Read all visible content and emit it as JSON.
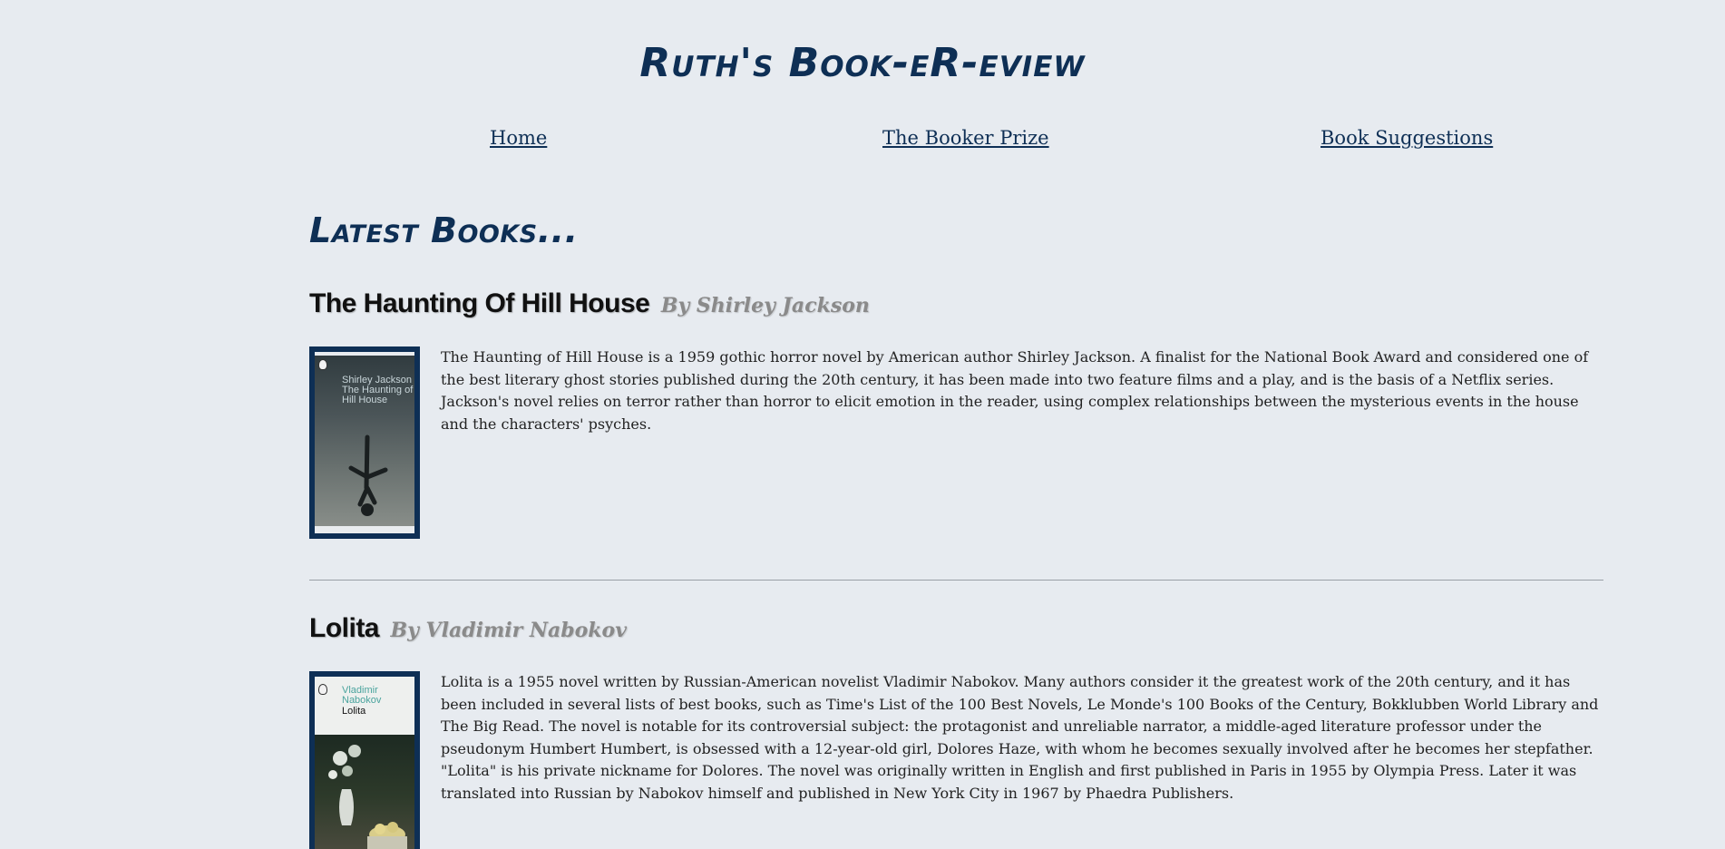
{
  "site": {
    "title": "Ruth's Book-eR-eview"
  },
  "nav": {
    "items": [
      {
        "label": "Home"
      },
      {
        "label": "The Booker Prize"
      },
      {
        "label": "Book Suggestions"
      }
    ]
  },
  "main": {
    "heading": "Latest Books...",
    "books": [
      {
        "title": "The Haunting Of Hill House",
        "author": "By Shirley Jackson",
        "cover": {
          "author": "Shirley Jackson",
          "title": "The Haunting of Hill House",
          "colors": {
            "frame": "#0e2f55"
          }
        },
        "description": "The Haunting of Hill House is a 1959 gothic horror novel by American author Shirley Jackson. A finalist for the National Book Award and considered one of the best literary ghost stories published during the 20th century, it has been made into two feature films and a play, and is the basis of a Netflix series. Jackson's novel relies on terror rather than horror to elicit emotion in the reader, using complex relationships between the mysterious events in the house and the characters' psyches."
      },
      {
        "title": "Lolita",
        "author": "By Vladimir Nabokov",
        "cover": {
          "author": "Vladimir Nabokov",
          "title": "Lolita",
          "colors": {
            "frame": "#0e2f55"
          }
        },
        "description": "Lolita is a 1955 novel written by Russian-American novelist Vladimir Nabokov. Many authors consider it the greatest work of the 20th century, and it has been included in several lists of best books, such as Time's List of the 100 Best Novels, Le Monde's 100 Books of the Century, Bokklubben World Library and The Big Read. The novel is notable for its controversial subject: the protagonist and unreliable narrator, a middle-aged literature professor under the pseudonym Humbert Humbert, is obsessed with a 12-year-old girl, Dolores Haze, with whom he becomes sexually involved after he becomes her stepfather. \"Lolita\" is his private nickname for Dolores. The novel was originally written in English and first published in Paris in 1955 by Olympia Press. Later it was translated into Russian by Nabokov himself and published in New York City in 1967 by Phaedra Publishers."
      }
    ]
  },
  "colors": {
    "background": "#e7ebf0",
    "accent": "#0e2f55",
    "author_gray": "#8a8a8a"
  }
}
